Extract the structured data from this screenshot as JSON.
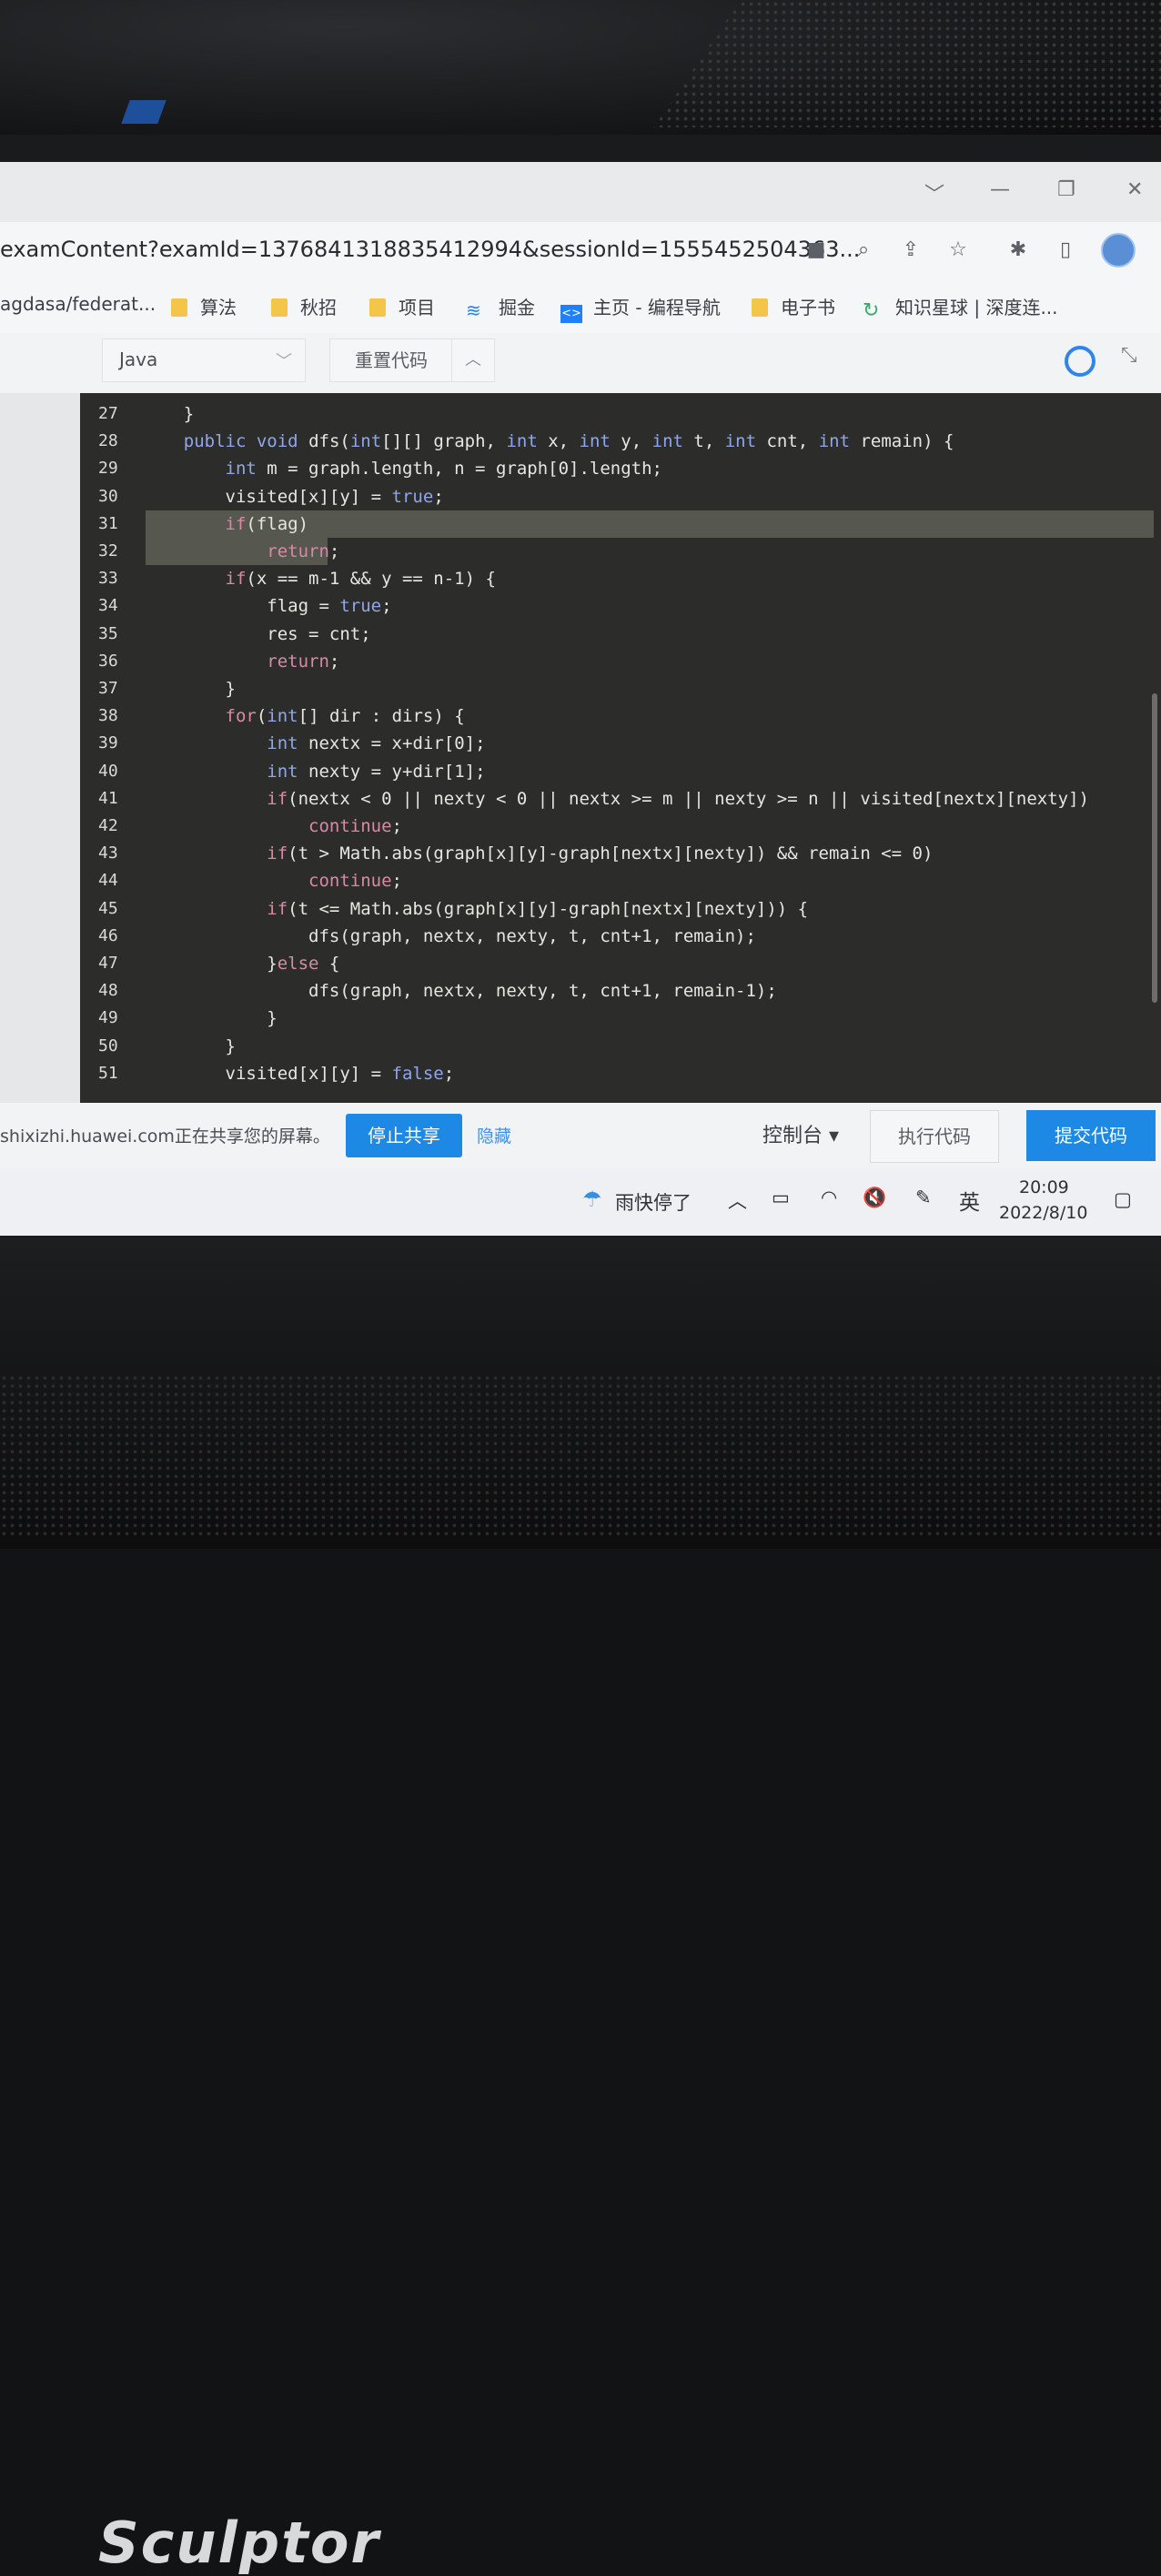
{
  "browser": {
    "url": "examContent?examId=1376841318835412994&sessionId=1555452504363...",
    "window_controls": [
      "﹀",
      "—",
      "❐",
      "✕"
    ],
    "bookmarks": [
      {
        "label": "agdasa/federat...",
        "icon": "none"
      },
      {
        "label": "算法",
        "icon": "folder-icon"
      },
      {
        "label": "秋招",
        "icon": "folder-icon"
      },
      {
        "label": "项目",
        "icon": "folder-icon"
      },
      {
        "label": "掘金",
        "icon": "juejin-icon"
      },
      {
        "label": "主页 - 编程导航",
        "icon": "code-nav-icon"
      },
      {
        "label": "电子书",
        "icon": "folder-icon"
      },
      {
        "label": "知识星球 | 深度连...",
        "icon": "planet-icon"
      }
    ]
  },
  "editor": {
    "language": "Java",
    "reset_label": "重置代码",
    "lines": [
      {
        "n": "27",
        "code": "    }"
      },
      {
        "n": "28",
        "code": "    public void dfs(int[][] graph, int x, int y, int t, int cnt, int remain) {"
      },
      {
        "n": "29",
        "code": "        int m = graph.length, n = graph[0].length;"
      },
      {
        "n": "30",
        "code": "        visited[x][y] = true;"
      },
      {
        "n": "31",
        "code": "        if(flag)"
      },
      {
        "n": "32",
        "code": "            return;"
      },
      {
        "n": "33",
        "code": "        if(x == m-1 && y == n-1) {"
      },
      {
        "n": "34",
        "code": "            flag = true;"
      },
      {
        "n": "35",
        "code": "            res = cnt;"
      },
      {
        "n": "36",
        "code": "            return;"
      },
      {
        "n": "37",
        "code": "        }"
      },
      {
        "n": "38",
        "code": "        for(int[] dir : dirs) {"
      },
      {
        "n": "39",
        "code": "            int nextx = x+dir[0];"
      },
      {
        "n": "40",
        "code": "            int nexty = y+dir[1];"
      },
      {
        "n": "41",
        "code": "            if(nextx < 0 || nexty < 0 || nextx >= m || nexty >= n || visited[nextx][nexty])"
      },
      {
        "n": "42",
        "code": "                continue;"
      },
      {
        "n": "43",
        "code": "            if(t > Math.abs(graph[x][y]-graph[nextx][nexty]) && remain <= 0)"
      },
      {
        "n": "44",
        "code": "                continue;"
      },
      {
        "n": "45",
        "code": "            if(t <= Math.abs(graph[x][y]-graph[nextx][nexty])) {"
      },
      {
        "n": "46",
        "code": "                dfs(graph, nextx, nexty, t, cnt+1, remain);"
      },
      {
        "n": "47",
        "code": "            }else {"
      },
      {
        "n": "48",
        "code": "                dfs(graph, nextx, nexty, t, cnt+1, remain-1);"
      },
      {
        "n": "49",
        "code": "            }"
      },
      {
        "n": "50",
        "code": "        }"
      },
      {
        "n": "51",
        "code": "        visited[x][y] = false;"
      }
    ]
  },
  "bottom_bar": {
    "share_message": "shixizhi.huawei.com正在共享您的屏幕。",
    "stop_share_label": "停止共享",
    "hide_label": "隐藏",
    "console_label": "控制台 ▾",
    "run_label": "执行代码",
    "submit_label": "提交代码"
  },
  "taskbar": {
    "weather": "雨快停了",
    "ime": "英",
    "time": "20:09",
    "date": "2022/8/10"
  },
  "monitor": {
    "brand": "Sculptor"
  },
  "colors": {
    "accent_blue": "#1e88e5",
    "editor_bg": "#2c2d2b",
    "keyword": "#8fa6e8",
    "control": "#d78aa8"
  }
}
